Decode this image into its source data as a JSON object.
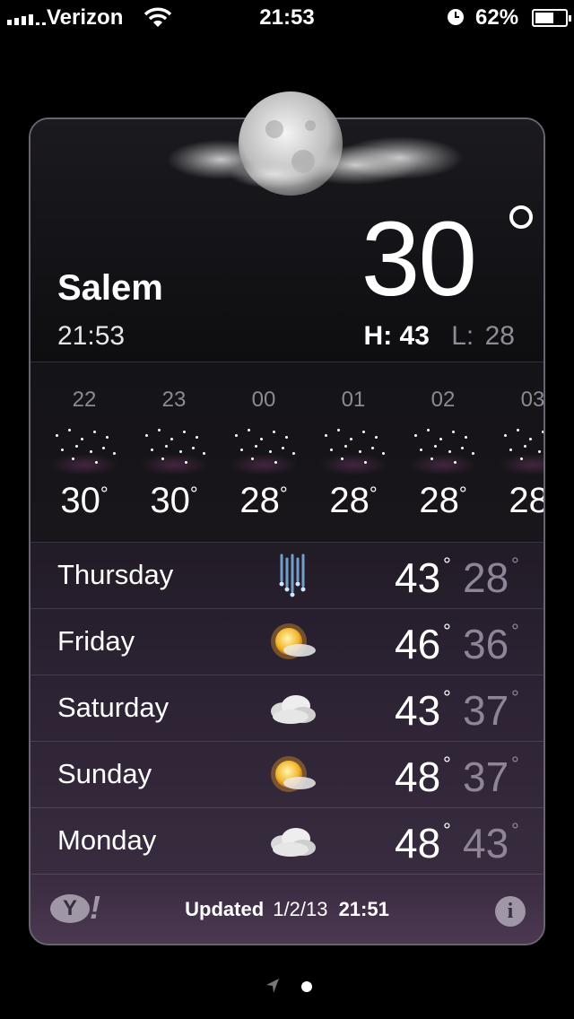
{
  "status_bar": {
    "carrier": "Verizon",
    "time": "21:53",
    "battery_percent": "62%",
    "battery_level": 0.62,
    "icons": [
      "signal-icon",
      "wifi-icon",
      "alarm-icon",
      "battery-icon"
    ]
  },
  "current": {
    "city": "Salem",
    "local_time": "21:53",
    "temperature": "30",
    "high_label": "H:",
    "high": "43",
    "low_label": "L:",
    "low": "28",
    "condition_icon": "moon-cloud-icon"
  },
  "hourly": [
    {
      "hour": "22",
      "temp": "30",
      "icon": "clear-night-stars-icon"
    },
    {
      "hour": "23",
      "temp": "30",
      "icon": "clear-night-stars-icon"
    },
    {
      "hour": "00",
      "temp": "28",
      "icon": "clear-night-stars-icon"
    },
    {
      "hour": "01",
      "temp": "28",
      "icon": "clear-night-stars-icon"
    },
    {
      "hour": "02",
      "temp": "28",
      "icon": "clear-night-stars-icon"
    },
    {
      "hour": "03",
      "temp": "28",
      "icon": "clear-night-stars-icon"
    }
  ],
  "daily": [
    {
      "day": "Thursday",
      "hi": "43",
      "lo": "28",
      "icon": "rain-icon"
    },
    {
      "day": "Friday",
      "hi": "46",
      "lo": "36",
      "icon": "sun-cloud-icon"
    },
    {
      "day": "Saturday",
      "hi": "43",
      "lo": "37",
      "icon": "cloud-icon"
    },
    {
      "day": "Sunday",
      "hi": "48",
      "lo": "37",
      "icon": "sun-cloud-icon"
    },
    {
      "day": "Monday",
      "hi": "48",
      "lo": "43",
      "icon": "cloud-icon"
    }
  ],
  "footer": {
    "updated_label": "Updated",
    "updated_date": "1/2/13",
    "updated_time": "21:51",
    "yahoo_logo": "Y!",
    "info_icon": "info-icon"
  },
  "degree_symbol": "°",
  "colors": {
    "background": "#000000",
    "card_bottom": "#4b3952",
    "low_temp": "#8e8597"
  }
}
